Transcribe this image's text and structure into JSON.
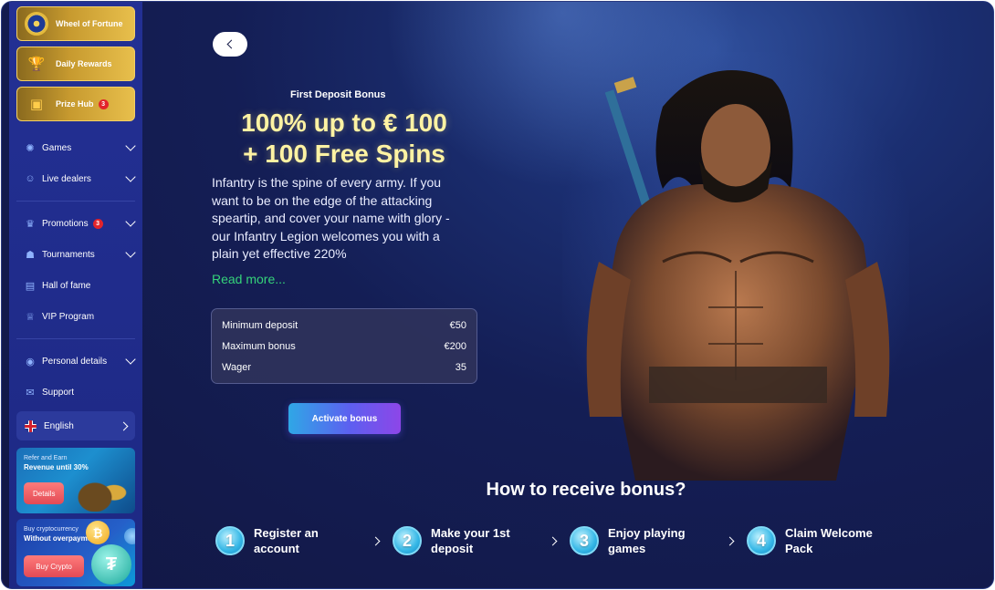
{
  "sidebar": {
    "tiles": [
      {
        "label": "Wheel of Fortune",
        "icon": "wheel-icon"
      },
      {
        "label": "Daily Rewards",
        "icon": "trophy-icon"
      },
      {
        "label": "Prize Hub",
        "icon": "treasure-chest-icon",
        "badge": "3"
      }
    ],
    "nav": [
      {
        "label": "Games",
        "icon": "games-icon",
        "expandable": true
      },
      {
        "label": "Live dealers",
        "icon": "live-dealers-icon",
        "expandable": true
      },
      {
        "label": "Promotions",
        "icon": "promotions-icon",
        "expandable": true,
        "badge": "3"
      },
      {
        "label": "Tournaments",
        "icon": "tournaments-icon",
        "expandable": true
      },
      {
        "label": "Hall of fame",
        "icon": "hall-of-fame-icon"
      },
      {
        "label": "VIP Program",
        "icon": "crown-icon"
      },
      {
        "label": "Personal details",
        "icon": "user-icon",
        "expandable": true
      },
      {
        "label": "Support",
        "icon": "support-icon"
      }
    ],
    "language": {
      "label": "English"
    },
    "refer_banner": {
      "small": "Refer and Earn",
      "big": "Revenue until 30%",
      "button": "Details"
    },
    "crypto_banner": {
      "small": "Buy cryptocurrency",
      "big": "Without overpayments",
      "button": "Buy Crypto"
    }
  },
  "bonus": {
    "kicker": "First Deposit Bonus",
    "title_line1": "100% up to € 100",
    "title_line2": "+ 100 Free Spins",
    "description": "Infantry is the spine of every army. If you want to be on the edge of the attacking speartip, and cover your name with glory - our Infantry Legion welcomes you with a plain yet effective 220%",
    "read_more": "Read more...",
    "terms": [
      {
        "label": "Minimum deposit",
        "value": "€50"
      },
      {
        "label": "Maximum bonus",
        "value": "€200"
      },
      {
        "label": "Wager",
        "value": "35"
      }
    ],
    "activate_label": "Activate bonus"
  },
  "how": {
    "title": "How to receive bonus?",
    "steps": [
      {
        "num": "1",
        "line1": "Register an",
        "line2": "account"
      },
      {
        "num": "2",
        "line1": "Make your 1st",
        "line2": "deposit"
      },
      {
        "num": "3",
        "line1": "Enjoy playing",
        "line2": "games"
      },
      {
        "num": "4",
        "line1": "Claim Welcome",
        "line2": "Pack"
      }
    ]
  },
  "colors": {
    "accent_gold": "#fff3a3",
    "link_green": "#35d37a",
    "badge_red": "#e3242b",
    "sidebar_bg": "#233094"
  }
}
